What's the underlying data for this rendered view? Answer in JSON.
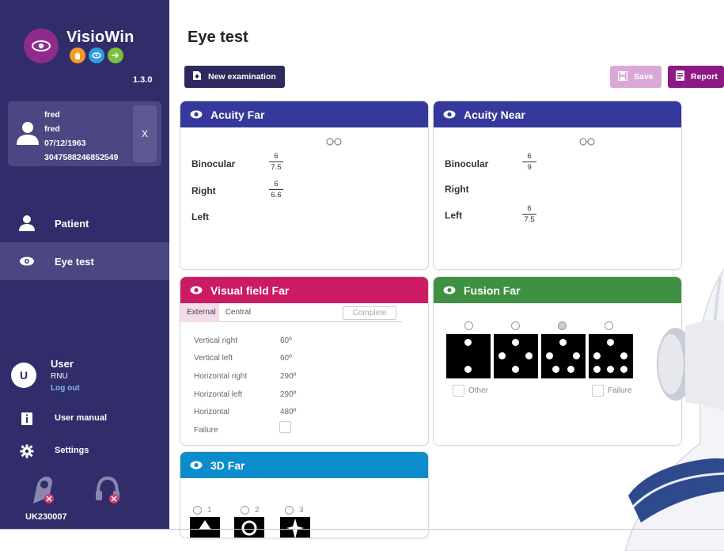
{
  "app": {
    "name": "VisioWin",
    "version": "1.3.0",
    "brand_color": "#8e2b8b",
    "sidebar_color": "#312d6a"
  },
  "patient": {
    "line1": "fred",
    "line2": "fred",
    "dob": "07/12/1963",
    "id": "3047588246852549",
    "close_label": "X"
  },
  "nav": {
    "patient_label": "Patient",
    "eyetest_label": "Eye test"
  },
  "user": {
    "initial": "U",
    "name": "User",
    "org": "RNU",
    "logout": "Log out"
  },
  "links": {
    "manual": "User manual",
    "settings": "Settings"
  },
  "device_id": "UK230007",
  "header": {
    "title": "Eye test",
    "new_exam": "New examination",
    "save": "Save",
    "report": "Report"
  },
  "acuity_far": {
    "title": "Acuity Far",
    "binocular_label": "Binocular",
    "binocular_num": "6",
    "binocular_den": "7.5",
    "right_label": "Right",
    "right_num": "6",
    "right_den": "6.6",
    "left_label": "Left",
    "color": "#34399b"
  },
  "acuity_near": {
    "title": "Acuity Near",
    "binocular_label": "Binocular",
    "binocular_num": "6",
    "binocular_den": "9",
    "right_label": "Right",
    "left_label": "Left",
    "left_num": "6",
    "left_den": "7.5",
    "color": "#34399b"
  },
  "visual_field": {
    "title": "Visual field Far",
    "tab_external": "External",
    "tab_central": "Central",
    "complete": "Complete",
    "rows": [
      {
        "label": "Vertical right",
        "value": "60º"
      },
      {
        "label": "Vertical left",
        "value": "60º"
      },
      {
        "label": "Horizontal right",
        "value": "290º"
      },
      {
        "label": "Horizontal left",
        "value": "290º"
      },
      {
        "label": "Horizontal",
        "value": "480º"
      },
      {
        "label": "Failure",
        "value": ""
      }
    ],
    "color": "#cc1a64"
  },
  "fusion": {
    "title": "Fusion Far",
    "other_label": "Other",
    "failure_label": "Failure",
    "selected_option": 3,
    "color": "#3f9142"
  },
  "three_d": {
    "title": "3D Far",
    "options": [
      "1",
      "2",
      "3"
    ],
    "color": "#0d8ccc"
  },
  "icons": [
    "eye-logo-icon",
    "hand-icon",
    "eye-icon",
    "cursor-icon",
    "person-icon",
    "glasses-icon",
    "info-icon",
    "gear-icon",
    "document-icon",
    "save-icon",
    "report-icon"
  ]
}
